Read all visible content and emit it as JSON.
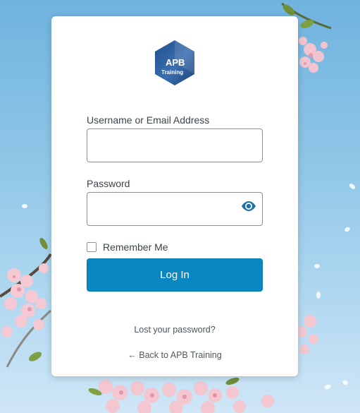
{
  "brand": {
    "logo_text_top": "APB",
    "logo_text_bottom": "Training",
    "logo_color": "#2f5f9e"
  },
  "form": {
    "username_label": "Username or Email Address",
    "username_value": "",
    "password_label": "Password",
    "password_value": "",
    "remember_label": "Remember Me",
    "remember_checked": false,
    "submit_label": "Log In"
  },
  "links": {
    "lost_password": "Lost your password?",
    "back_to_site": "← Back to APB Training"
  },
  "colors": {
    "primary_button": "#0a86c2",
    "eye_icon": "#1d6fa5",
    "background_sky": "#7bbbe2"
  },
  "icons": {
    "password_toggle": "eye-icon"
  }
}
